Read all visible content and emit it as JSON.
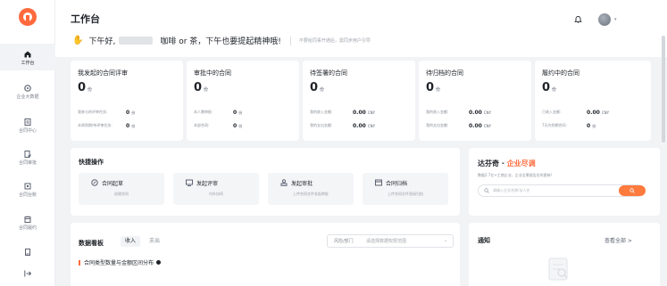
{
  "sidebar": {
    "logo": "orange-circle-logo",
    "items": [
      {
        "label": "工作台",
        "icon": "home-icon",
        "active": true
      },
      {
        "label": "企业大数据",
        "icon": "analytics-icon"
      },
      {
        "label": "合同中心",
        "icon": "document-icon"
      },
      {
        "label": "合同审批",
        "icon": "approval-icon"
      },
      {
        "label": "合同台账",
        "icon": "ledger-icon"
      },
      {
        "label": "合同履约",
        "icon": "fulfillment-icon"
      },
      {
        "label": "",
        "icon": "file-icon"
      },
      {
        "label": "",
        "icon": "collapse-icon"
      }
    ]
  },
  "header": {
    "title": "工作台",
    "greeting_prefix": "下午好,",
    "greeting_suffix": "咖啡 or 茶，下午也要提起精神哦!",
    "tip": "不要给同事开通后，需同步用户引导"
  },
  "stats": [
    {
      "title": "我发起的合同评审",
      "value": "0",
      "unit": "份",
      "rows": [
        {
          "label": "我参与的评审任务:",
          "value": "0",
          "unit": "份"
        },
        {
          "label": "本周到期/待评审任务:",
          "value": "0",
          "unit": "份"
        }
      ]
    },
    {
      "title": "审批中的合同",
      "value": "0",
      "unit": "份",
      "rows": [
        {
          "label": "本人需审批:",
          "value": "0",
          "unit": "份"
        },
        {
          "label": "本部合同:",
          "value": "0",
          "unit": "份"
        }
      ]
    },
    {
      "title": "待签署的合同",
      "value": "0",
      "unit": "份",
      "rows": [
        {
          "label": "我的收入金额:",
          "value": "0.00",
          "unit": "CNY"
        },
        {
          "label": "我的支出金额:",
          "value": "0.00",
          "unit": "CNY"
        }
      ]
    },
    {
      "title": "待归档的合同",
      "value": "0",
      "unit": "份",
      "rows": [
        {
          "label": "我的收入金额:",
          "value": "0.00",
          "unit": "CNY"
        },
        {
          "label": "我的支出金额:",
          "value": "0.00",
          "unit": "CNY"
        }
      ]
    },
    {
      "title": "履约中的合同",
      "value": "0",
      "unit": "份",
      "rows": [
        {
          "label": "已收入金额:",
          "value": "0.00",
          "unit": "CNY"
        },
        {
          "label": "7天内到期合同:",
          "value": "0",
          "unit": "份"
        }
      ]
    }
  ],
  "quick_actions": {
    "title": "快捷操作",
    "items": [
      {
        "label": "合同起草",
        "sub": "创建合同",
        "icon": "draft-icon"
      },
      {
        "label": "发起评审",
        "sub": "内外协同",
        "icon": "review-icon"
      },
      {
        "label": "发起审批",
        "sub": "上传合同文件发起审批",
        "icon": "stamp-icon"
      },
      {
        "label": "合同归档",
        "sub": "上传合同文件直接归档",
        "icon": "archive-icon"
      }
    ]
  },
  "promo": {
    "title_a": "达芬奇 · ",
    "title_b": "企业尽调",
    "desc_a": "数据2.7亿+工商企业，企业全景报告实时更新!",
    "search_placeholder": "请输入企业名称/法人名"
  },
  "board": {
    "title": "数据看板",
    "tabs": [
      "收入",
      "支出"
    ],
    "dept_prefix": "风险/部门",
    "dept_placeholder": "请选择数据权限范围",
    "subheading": "合同类型数量与金额区间分布"
  },
  "notice": {
    "title": "通知",
    "view_all": "查看全部 >"
  },
  "colors": {
    "accent": "#ff6a3d",
    "background": "#f2f3f5"
  }
}
